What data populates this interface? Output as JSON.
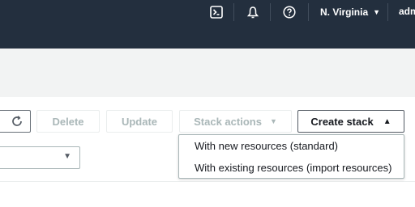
{
  "topbar": {
    "icons": [
      "terminal-icon",
      "bell-icon",
      "help-icon"
    ],
    "region_label": "N. Virginia",
    "region_caret": "▼",
    "user_label": "adm"
  },
  "toolbar": {
    "refresh_icon": "refresh-icon",
    "delete_label": "Delete",
    "update_label": "Update",
    "stack_actions_label": "Stack actions",
    "stack_actions_caret": "▼",
    "create_stack_label": "Create stack",
    "create_stack_caret": "▲"
  },
  "filter": {
    "select_caret": "▼"
  },
  "create_stack_menu": {
    "items": [
      {
        "label": "With new resources (standard)"
      },
      {
        "label": "With existing resources (import resources)"
      }
    ]
  },
  "colors": {
    "topbar_bg": "#232f3e",
    "page_bg": "#f2f3f3",
    "disabled_text": "#aab7b8"
  }
}
